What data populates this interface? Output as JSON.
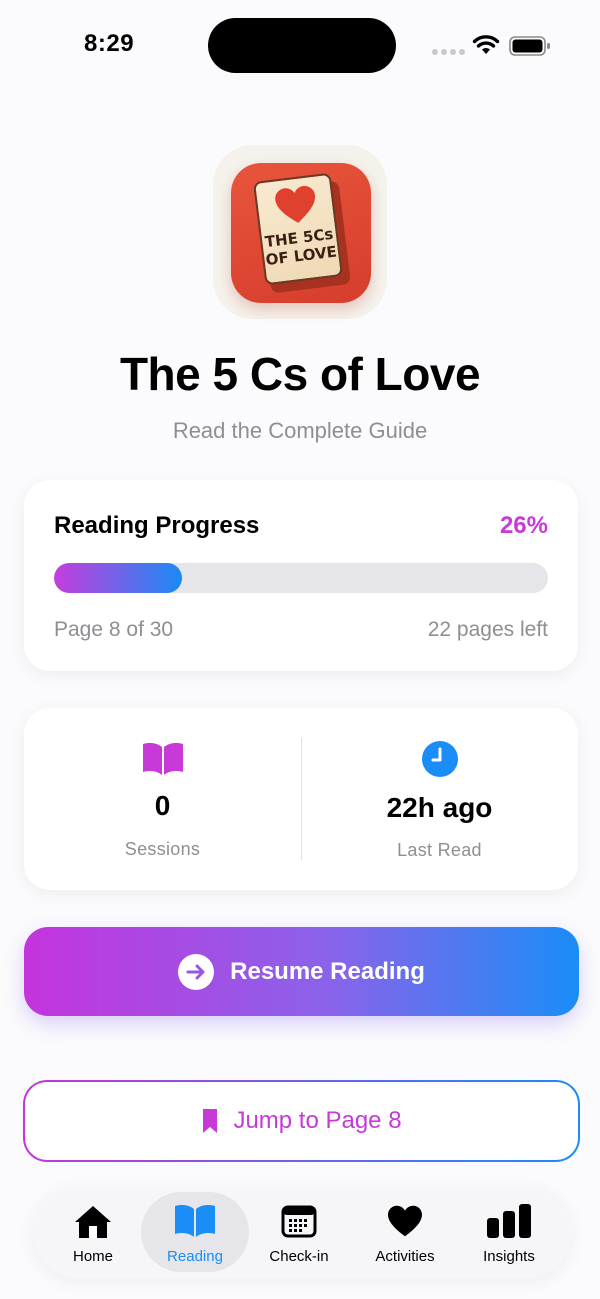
{
  "status_bar": {
    "time": "8:29"
  },
  "app_icon": {
    "book_title": "THE 5Cs\nOF LOVE"
  },
  "header": {
    "title": "The 5 Cs of Love",
    "subtitle": "Read the Complete Guide"
  },
  "progress": {
    "label": "Reading Progress",
    "percent_text": "26%",
    "fill_fraction": 0.26,
    "page_text": "Page 8 of 30",
    "pages_left_text": "22 pages left"
  },
  "stats": {
    "sessions": {
      "value": "0",
      "caption": "Sessions",
      "icon": "book-open-icon"
    },
    "last_read": {
      "value": "22h ago",
      "caption": "Last Read",
      "icon": "clock-icon"
    }
  },
  "buttons": {
    "resume_label": "Resume Reading",
    "jump_label": "Jump to Page 8"
  },
  "tab_bar": {
    "items": [
      {
        "label": "Home",
        "icon": "house-icon"
      },
      {
        "label": "Reading",
        "icon": "book-open-icon",
        "active": true
      },
      {
        "label": "Check-in",
        "icon": "calendar-icon"
      },
      {
        "label": "Activities",
        "icon": "heart-icon"
      },
      {
        "label": "Insights",
        "icon": "bar-chart-icon"
      }
    ]
  },
  "colors": {
    "accent_purple": "#c73ad8",
    "accent_blue": "#1a8df7",
    "app_icon_red": "#e8553c"
  }
}
